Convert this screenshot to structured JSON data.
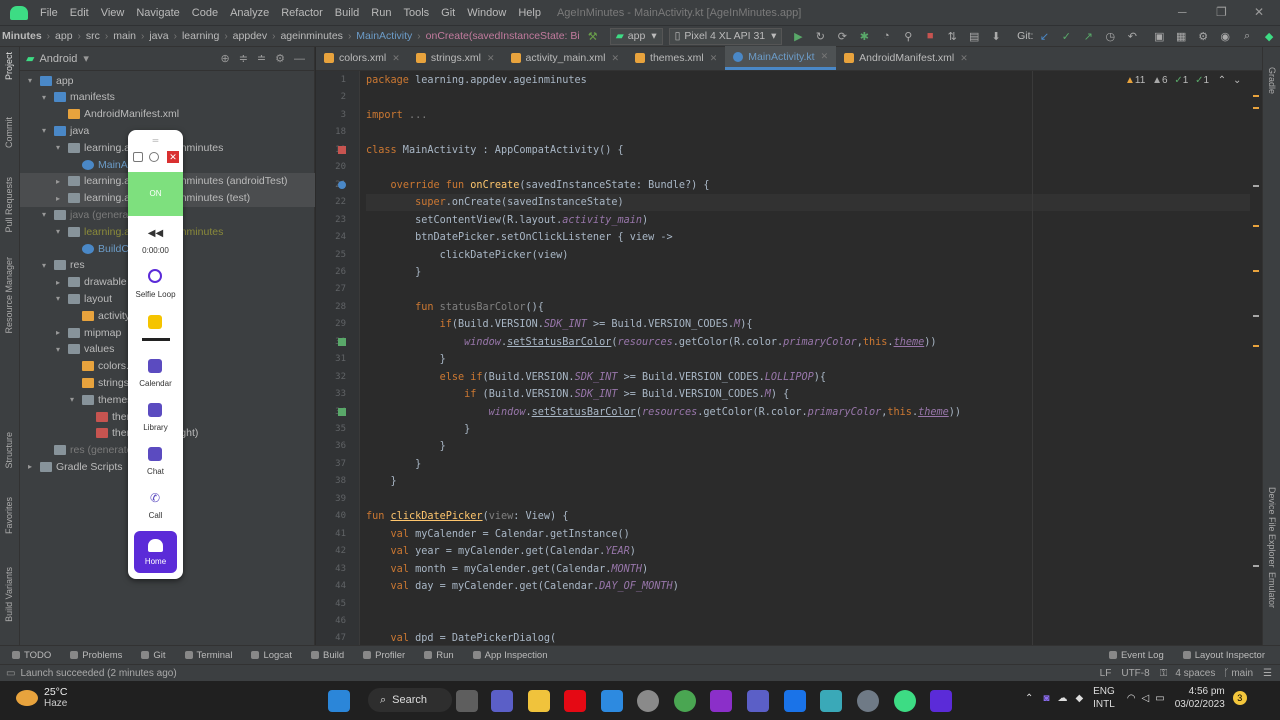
{
  "menubar": {
    "items": [
      "File",
      "Edit",
      "View",
      "Navigate",
      "Code",
      "Analyze",
      "Refactor",
      "Build",
      "Run",
      "Tools",
      "Git",
      "Window",
      "Help"
    ],
    "window_title": "AgeInMinutes - MainActivity.kt [AgeInMinutes.app]"
  },
  "navbar": {
    "crumbs": [
      "Minutes",
      "app",
      "src",
      "main",
      "java",
      "learning",
      "appdev",
      "ageinminutes",
      "MainActivity",
      "onCreate(savedInstanceState: Bi"
    ],
    "run_config": "app",
    "device": "Pixel 4 XL API 31",
    "git_label": "Git:"
  },
  "project": {
    "view_selector": "Android",
    "tree": [
      {
        "label": "app",
        "indent": 0,
        "arrow": "▾",
        "icon": "folder-blue"
      },
      {
        "label": "manifests",
        "indent": 1,
        "arrow": "▾",
        "icon": "folder-blue"
      },
      {
        "label": "AndroidManifest.xml",
        "indent": 2,
        "arrow": "",
        "icon": "xml"
      },
      {
        "label": "java",
        "indent": 1,
        "arrow": "▾",
        "icon": "folder-blue"
      },
      {
        "label": "learning.appdev.ageinminutes",
        "indent": 2,
        "arrow": "▾",
        "icon": "folder"
      },
      {
        "label": "MainActivity",
        "indent": 3,
        "arrow": "",
        "icon": "kt",
        "blue": true
      },
      {
        "label": "learning.appdev.ageinminutes (androidTest)",
        "indent": 2,
        "arrow": "▸",
        "icon": "folder",
        "sel": true
      },
      {
        "label": "learning.appdev.ageinminutes (test)",
        "indent": 2,
        "arrow": "▸",
        "icon": "folder",
        "sel": true
      },
      {
        "label": "java (generated)",
        "indent": 1,
        "arrow": "▾",
        "icon": "folder",
        "dim": true
      },
      {
        "label": "learning.appdev.ageinminutes",
        "indent": 2,
        "arrow": "▾",
        "icon": "folder",
        "olive": true
      },
      {
        "label": "BuildConfig",
        "indent": 3,
        "arrow": "",
        "icon": "kt",
        "blue": true
      },
      {
        "label": "res",
        "indent": 1,
        "arrow": "▾",
        "icon": "folder"
      },
      {
        "label": "drawable",
        "indent": 2,
        "arrow": "▸",
        "icon": "folder"
      },
      {
        "label": "layout",
        "indent": 2,
        "arrow": "▾",
        "icon": "folder"
      },
      {
        "label": "activity_main.xml",
        "indent": 3,
        "arrow": "",
        "icon": "xml"
      },
      {
        "label": "mipmap",
        "indent": 2,
        "arrow": "▸",
        "icon": "folder"
      },
      {
        "label": "values",
        "indent": 2,
        "arrow": "▾",
        "icon": "folder"
      },
      {
        "label": "colors.xml",
        "indent": 3,
        "arrow": "",
        "icon": "xml"
      },
      {
        "label": "strings.xml",
        "indent": 3,
        "arrow": "",
        "icon": "xml"
      },
      {
        "label": "themes (2)",
        "indent": 3,
        "arrow": "▾",
        "icon": "folder"
      },
      {
        "label": "themes.xml",
        "indent": 4,
        "arrow": "",
        "icon": "xml",
        "red": true
      },
      {
        "label": "themes.xml (night)",
        "indent": 4,
        "arrow": "",
        "icon": "xml",
        "red": true
      },
      {
        "label": "res (generated)",
        "indent": 1,
        "arrow": "",
        "icon": "folder",
        "dim": true
      },
      {
        "label": "Gradle Scripts",
        "indent": 0,
        "arrow": "▸",
        "icon": "folder"
      }
    ]
  },
  "left_strip": [
    "Project",
    "Commit",
    "Pull Requests",
    "Resource Manager",
    "Structure",
    "Favorites",
    "Build Variants"
  ],
  "right_strip": [
    "Gradle",
    "Device File Explorer",
    "Emulator"
  ],
  "tabs": [
    {
      "label": "colors.xml",
      "active": false
    },
    {
      "label": "strings.xml",
      "active": false
    },
    {
      "label": "activity_main.xml",
      "active": false
    },
    {
      "label": "themes.xml",
      "active": false
    },
    {
      "label": "MainActivity.kt",
      "active": true
    },
    {
      "label": "AndroidManifest.xml",
      "active": false
    }
  ],
  "inspections": {
    "warnings": "11",
    "weak": "6",
    "typos": "1",
    "ok": "1"
  },
  "code_lines": [
    {
      "n": "1",
      "html": "<span class=\"kw\">package</span> learning.appdev.ageinminutes"
    },
    {
      "n": "2",
      "html": ""
    },
    {
      "n": "3",
      "html": "<span class=\"kw\">import</span> <span class=\"gr\">...</span>"
    },
    {
      "n": "18",
      "html": ""
    },
    {
      "n": "19",
      "html": "<span class=\"kw\">class</span> MainActivity : AppCompatActivity() {"
    },
    {
      "n": "20",
      "html": ""
    },
    {
      "n": "21",
      "html": "    <span class=\"kw\">override fun</span> <span class=\"fn\">onCreate</span>(savedInstanceState: Bundle?) {"
    },
    {
      "n": "22",
      "html": "        <span class=\"kw\">super</span>.onCreate(savedInstanceState)"
    },
    {
      "n": "23",
      "html": "        setContentView(R.layout.<span class=\"pr\">activity_main</span>)"
    },
    {
      "n": "24",
      "html": "        btnDatePicker.setOnClickListener { view ->"
    },
    {
      "n": "25",
      "html": "            clickDatePicker(view)"
    },
    {
      "n": "26",
      "html": "        }"
    },
    {
      "n": "27",
      "html": ""
    },
    {
      "n": "28",
      "html": "        <span class=\"kw\">fun</span> <span class=\"gr\">statusBarColor</span>(){"
    },
    {
      "n": "29",
      "html": "            <span class=\"kw\">if</span>(Build.VERSION.<span class=\"pr\">SDK_INT</span> >= Build.VERSION_CODES.<span class=\"pr\">M</span>){"
    },
    {
      "n": "30",
      "html": "                <span class=\"pr\">window</span>.<span class=\"ul\">setStatusBarColor</span>(<span class=\"pr\">resources</span>.getColor(R.color.<span class=\"pr\">primaryColor</span>,<span class=\"kw\">this</span>.<span class=\"pr ul\">theme</span>))"
    },
    {
      "n": "31",
      "html": "            }"
    },
    {
      "n": "32",
      "html": "            <span class=\"kw\">else if</span>(Build.VERSION.<span class=\"pr\">SDK_INT</span> >= Build.VERSION_CODES.<span class=\"pr\">LOLLIPOP</span>){"
    },
    {
      "n": "33",
      "html": "                <span class=\"kw\">if</span> (Build.VERSION.<span class=\"pr\">SDK_INT</span> >= Build.VERSION_CODES.<span class=\"pr\">M</span>) {"
    },
    {
      "n": "34",
      "html": "                    <span class=\"pr\">window</span>.<span class=\"ul\">setStatusBarColor</span>(<span class=\"pr\">resources</span>.getColor(R.color.<span class=\"pr\">primaryColor</span>,<span class=\"kw\">this</span>.<span class=\"pr ul\">theme</span>))"
    },
    {
      "n": "35",
      "html": "                }"
    },
    {
      "n": "36",
      "html": "            }"
    },
    {
      "n": "37",
      "html": "        }"
    },
    {
      "n": "38",
      "html": "    }"
    },
    {
      "n": "39",
      "html": ""
    },
    {
      "n": "40",
      "html": "<span class=\"kw\">fun</span> <span class=\"fn ul\">clickDatePicker</span>(<span class=\"gr\">view</span>: View) {"
    },
    {
      "n": "41",
      "html": "    <span class=\"kw\">val</span> myCalender = Calendar.getInstance()"
    },
    {
      "n": "42",
      "html": "    <span class=\"kw\">val</span> year = myCalender.get(Calendar.<span class=\"pr\">YEAR</span>)"
    },
    {
      "n": "43",
      "html": "    <span class=\"kw\">val</span> month = myCalender.get(Calendar.<span class=\"pr\">MONTH</span>)"
    },
    {
      "n": "44",
      "html": "    <span class=\"kw\">val</span> day = myCalender.get(Calendar.<span class=\"pr\">DAY_OF_MONTH</span>)"
    },
    {
      "n": "45",
      "html": ""
    },
    {
      "n": "46",
      "html": ""
    },
    {
      "n": "47",
      "html": "    <span class=\"kw\">val</span> dpd = DatePickerDialog("
    }
  ],
  "bottom_tools": [
    "TODO",
    "Problems",
    "Git",
    "Terminal",
    "Logcat",
    "Build",
    "Profiler",
    "Run",
    "App Inspection"
  ],
  "bottom_right_tools": [
    "Event Log",
    "Layout Inspector"
  ],
  "status": {
    "message": "Launch succeeded (2 minutes ago)",
    "line_sep": "LF",
    "encoding": "UTF-8",
    "indent": "4 spaces",
    "branch": "main"
  },
  "widget": {
    "toggle_label": "ON",
    "timer": "0:00:00",
    "items": [
      "Selfie Loop",
      "Calendar",
      "Library",
      "Chat",
      "Call"
    ],
    "home_label": "Home",
    "accent": "#5b2bd8",
    "toggle_color": "#7ee07e"
  },
  "taskbar": {
    "temperature": "25°C",
    "condition": "Haze",
    "search_label": "Search",
    "lang_top": "ENG",
    "lang_bottom": "INTL",
    "time": "4:56 pm",
    "date": "03/02/2023",
    "notif_count": "3"
  }
}
